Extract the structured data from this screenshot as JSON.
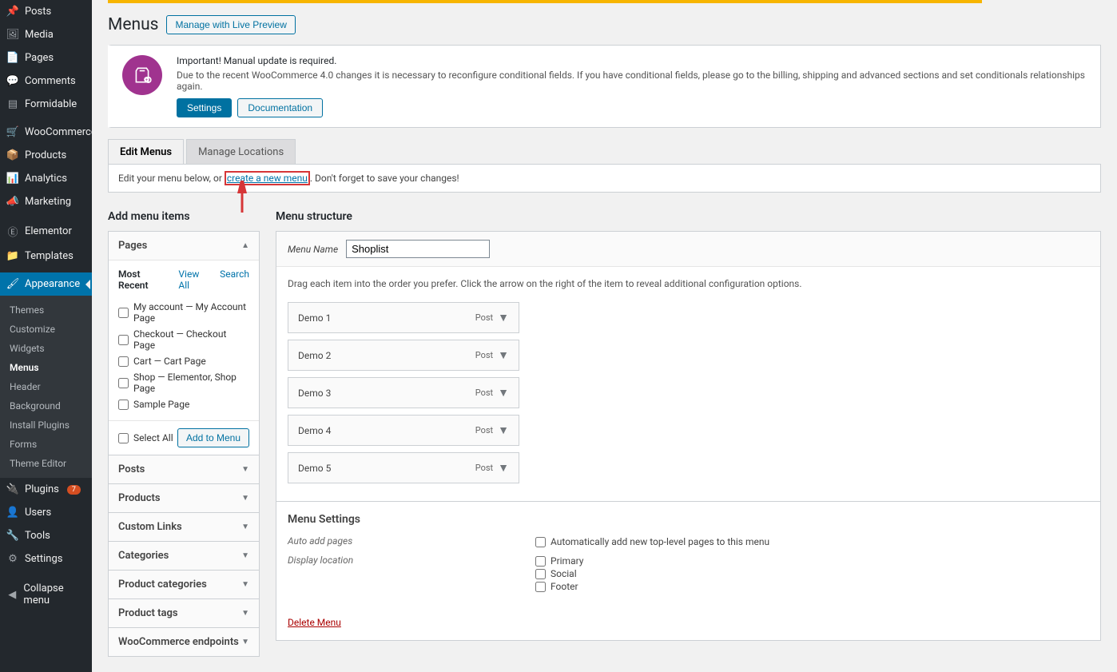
{
  "sidebar": {
    "items": [
      {
        "icon": "📌",
        "label": "Posts"
      },
      {
        "icon": "🖼",
        "label": "Media"
      },
      {
        "icon": "📄",
        "label": "Pages"
      },
      {
        "icon": "💬",
        "label": "Comments"
      },
      {
        "icon": "▤",
        "label": "Formidable"
      },
      {
        "icon": "🛒",
        "label": "WooCommerce"
      },
      {
        "icon": "📦",
        "label": "Products"
      },
      {
        "icon": "📊",
        "label": "Analytics"
      },
      {
        "icon": "📣",
        "label": "Marketing"
      },
      {
        "icon": "Ⓔ",
        "label": "Elementor"
      },
      {
        "icon": "📁",
        "label": "Templates"
      },
      {
        "icon": "🖌",
        "label": "Appearance"
      }
    ],
    "sub": [
      "Themes",
      "Customize",
      "Widgets",
      "Menus",
      "Header",
      "Background",
      "Install Plugins",
      "Forms",
      "Theme Editor"
    ],
    "after": [
      {
        "icon": "🔌",
        "label": "Plugins",
        "badge": "7"
      },
      {
        "icon": "👤",
        "label": "Users"
      },
      {
        "icon": "🔧",
        "label": "Tools"
      },
      {
        "icon": "⚙",
        "label": "Settings"
      }
    ],
    "collapse": "Collapse menu"
  },
  "header": {
    "title": "Menus",
    "preview_button": "Manage with Live Preview"
  },
  "notice": {
    "line1": "Important! Manual update is required.",
    "line2": "Due to the recent WooCommerce 4.0 changes it is necessary to reconfigure conditional fields. If you have conditional fields, please go to the billing, shipping and advanced sections and set conditionals relationships again.",
    "btn1": "Settings",
    "btn2": "Documentation"
  },
  "tabs": {
    "edit": "Edit Menus",
    "locations": "Manage Locations"
  },
  "helper": {
    "pre": "Edit your menu below, or ",
    "link": "create a new menu",
    "post": ". Don't forget to save your changes!"
  },
  "left": {
    "heading": "Add menu items",
    "pages": {
      "title": "Pages",
      "subtabs": {
        "recent": "Most Recent",
        "viewall": "View All",
        "search": "Search"
      },
      "items": [
        "My account — My Account Page",
        "Checkout — Checkout Page",
        "Cart — Cart Page",
        "Shop — Elementor, Shop Page",
        "Sample Page"
      ],
      "selectall": "Select All",
      "addbtn": "Add to Menu"
    },
    "closed": [
      "Posts",
      "Products",
      "Custom Links",
      "Categories",
      "Product categories",
      "Product tags",
      "WooCommerce endpoints"
    ]
  },
  "right": {
    "heading": "Menu structure",
    "name_label": "Menu Name",
    "name_value": "Shoplist",
    "hint": "Drag each item into the order you prefer. Click the arrow on the right of the item to reveal additional configuration options.",
    "items": [
      {
        "title": "Demo 1",
        "type": "Post"
      },
      {
        "title": "Demo 2",
        "type": "Post"
      },
      {
        "title": "Demo 3",
        "type": "Post"
      },
      {
        "title": "Demo 4",
        "type": "Post"
      },
      {
        "title": "Demo 5",
        "type": "Post"
      }
    ],
    "settings_h": "Menu Settings",
    "auto_label": "Auto add pages",
    "auto_opt": "Automatically add new top-level pages to this menu",
    "loc_label": "Display location",
    "locations": [
      "Primary",
      "Social",
      "Footer"
    ],
    "delete": "Delete Menu"
  }
}
